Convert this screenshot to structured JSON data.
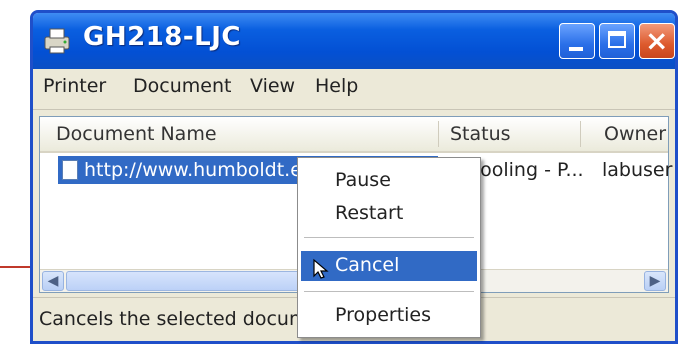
{
  "window": {
    "title": "GH218-LJC",
    "icon": "printer-icon",
    "controls": {
      "minimize": "minimize-icon",
      "maximize": "maximize-icon",
      "close": "×"
    }
  },
  "menubar": {
    "items": [
      "Printer",
      "Document",
      "View",
      "Help"
    ]
  },
  "list": {
    "columns": [
      "Document Name",
      "Status",
      "Owner"
    ],
    "rows": [
      {
        "name": "http://www.humboldt.edu/~mdm",
        "status": "Spooling - P...",
        "owner": "labuser"
      }
    ]
  },
  "context_menu": {
    "items": [
      "Pause",
      "Restart",
      "Cancel",
      "Properties"
    ],
    "highlighted": "Cancel"
  },
  "statusbar": {
    "text": "Cancels the selected docum..."
  },
  "colors": {
    "titlebar": "#0350d4",
    "selection": "#316ac5",
    "annotation_line": "#c0392b"
  }
}
